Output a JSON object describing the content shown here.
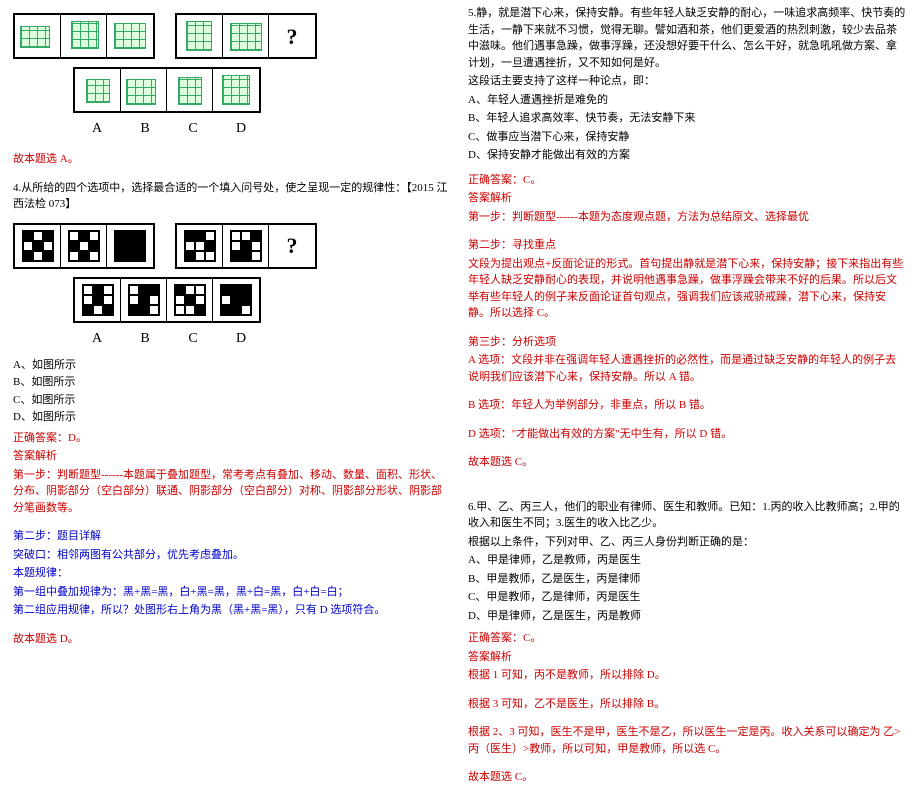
{
  "left": {
    "q3_answer": "故本题选 A。",
    "q4_stem": "4.从所给的四个选项中，选择最合适的一个填入问号处，使之呈现一定的规律性：【2015 江西法检 073】",
    "q4_options": {
      "a": "A、如图所示",
      "b": "B、如图所示",
      "c": "C、如图所示",
      "d": "D、如图所示"
    },
    "q4_answer": "正确答案：D。",
    "q4_analysis_label": "答案解析",
    "q4_step1": "第一步：判断题型------本题属于叠加题型，常考考点有叠加、移动、数量、面积、形状、分布、阴影部分（空白部分）联通、阴影部分（空白部分）对称、阴影部分形状、阴影部分笔画数等。",
    "q4_step2_label": "第二步：题目详解",
    "q4_breach": "突破口：相邻两图有公共部分，优先考虑叠加。",
    "q4_rule_label": "本题规律：",
    "q4_rule1": "第一组中叠加规律为：黑+黑=黑，白+黑=黑，黑+白=黑，白+白=白；",
    "q4_rule2": "第二组应用规律，所以？处图形右上角为黑（黑+黑=黑），只有 D 选项符合。",
    "q4_final": "故本题选 D。"
  },
  "right": {
    "q5_stem": "5.静，就是潜下心来，保持安静。有些年轻人缺乏安静的耐心，一味追求高频率、快节奏的生活，一静下来就不习惯，觉得无聊。譬如酒和茶，他们更爱酒的热烈刺激，较少去品茶中滋味。他们遇事急躁，做事浮躁，还没想好要干什么、怎么干好，就急吼吼做方案、拿计划，一旦遭遇挫折，又不知如何是好。",
    "q5_stem2": "这段话主要支持了这样一种论点，即：",
    "q5_a": "A、年轻人遭遇挫折是难免的",
    "q5_b": "B、年轻人追求高效率、快节奏，无法安静下来",
    "q5_c": "C、做事应当潜下心来，保持安静",
    "q5_d": "D、保持安静才能做出有效的方案",
    "q5_answer": "正确答案：C。",
    "q5_analysis": "答案解析",
    "q5_step1": "第一步：判断题型------本题为态度观点题，方法为总结原文、选择最优",
    "q5_step2_label": "第二步：寻找重点",
    "q5_step2": "文段为提出观点+反面论证的形式。首句提出静就是潜下心来，保持安静；接下来指出有些年轻人缺乏安静耐心的表现，并说明他遇事急躁，做事浮躁会带来不好的后果。所以后文举有些年轻人的例子来反面论证首句观点，强调我们应该戒骄戒躁，潜下心来，保持安静。所以选择 C。",
    "q5_step3_label": "第三步：分析选项",
    "q5_a_analysis": "A 选项：文段并非在强调年轻人遭遇挫折的必然性，而是通过缺乏安静的年轻人的例子去说明我们应该潜下心来，保持安静。所以 A 错。",
    "q5_b_analysis": "B 选项：年轻人为举例部分，非重点，所以 B 错。",
    "q5_d_analysis": "D 选项：\"才能做出有效的方案\"无中生有，所以 D 错。",
    "q5_final": "故本题选 C。",
    "q6_stem": "6.甲、乙、丙三人，他们的职业有律师、医生和教师。已知：1.丙的收入比教师高；2.甲的收入和医生不同；3.医生的收入比乙少。",
    "q6_q": "根据以上条件，下列对甲、乙、丙三人身份判断正确的是：",
    "q6_a": "A、甲是律师，乙是教师，丙是医生",
    "q6_b": "B、甲是教师，乙是医生，丙是律师",
    "q6_c": "C、甲是教师，乙是律师，丙是医生",
    "q6_d": "D、甲是律师，乙是医生，丙是教师",
    "q6_answer": "正确答案：C。",
    "q6_analysis": "答案解析",
    "q6_r1": "根据 1 可知，丙不是教师，所以排除 D。",
    "q6_r2": "根据 3 可知，乙不是医生，所以排除 B。",
    "q6_r3": "根据 2、3 可知，医生不是甲，医生不是乙，所以医生一定是丙。收入关系可以确定为 乙>丙（医生）>教师，所以可知，甲是教师，所以选 C。",
    "q6_final": "故本题选 C。"
  },
  "labels": {
    "a": "A",
    "b": "B",
    "c": "C",
    "d": "D"
  }
}
